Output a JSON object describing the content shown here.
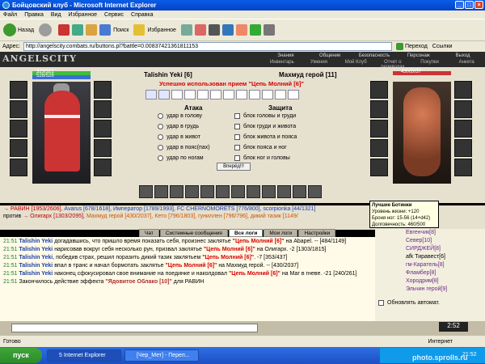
{
  "window": {
    "title": "Бойцовский клуб - Microsoft Internet Explorer"
  },
  "menu": [
    "Файл",
    "Правка",
    "Вид",
    "Избранное",
    "Сервис",
    "Справка"
  ],
  "toolbar": {
    "back": "Назад",
    "search": "Поиск",
    "favorites": "Избранное"
  },
  "address": {
    "label": "Адрес:",
    "url": "http://angelscity.combats.ru/buttons.pl?battle=0.00837421361811153",
    "go": "Переход",
    "links": "Ссылки"
  },
  "game": {
    "logo": "ANGELSCITY",
    "topnav": [
      "Знания",
      "Общение",
      "Безопасность",
      "Персонаж",
      "Выход"
    ],
    "subnav": [
      "Инвентарь",
      "Умения",
      "Мой Клуб",
      "Отчет о переводах",
      "Покупки",
      "Анкета"
    ]
  },
  "battle": {
    "left_hp": "323/321",
    "left_mana": "528/528",
    "right_hp": "430/2037",
    "left_name": "Talishin Yeki [6]",
    "right_name": "Махмуд герой [11]",
    "success": "Успешно использован прием \"Цепь Молний [6]\"",
    "attack_title": "Атака",
    "defense_title": "Защита",
    "attack": [
      "удар в голову",
      "удар в грудь",
      "удар в живот",
      "удар в пояс(пах)",
      "удар по ногам"
    ],
    "defense": [
      "блок головы и груди",
      "блок груди и живота",
      "блок живота и пояса",
      "блок пояса и ног",
      "блок ног и головы"
    ],
    "forward": "Вперёд!!!"
  },
  "lines": {
    "ravin": "→ РАВИН [1953/2606],",
    "avarus": "Avarus [678/1618],",
    "emperor": "Император [1789/1993],",
    "fc": "FC CHERNOMORETS [776/800],",
    "scorp": "scorpionka [44/1321]",
    "vs": "против",
    "olig": "→ Олигарх [1303/2095],",
    "mahmud": "Махмуд герой [430/2037],",
    "keto": "Кето [796/1803],",
    "gun": "гуниллен [796/796],",
    "dikiy": "дикий тазик [1149/"
  },
  "tooltip": {
    "title": "Лучшие Ботинки",
    "l1": "Уровень жизни: +120",
    "l2": "Броня ног: 15-56 (14+d42)",
    "l3": "Долговечность: 460/500"
  },
  "chat_tabs": [
    "Чат",
    "Системные сообщения",
    "Все логи",
    "Мои логи",
    "Настройки"
  ],
  "log": [
    {
      "t": "21:51",
      "a": "Talishin Yeki",
      "b": " догадавшись, что пришло время показать себя, произнес заклятье ",
      "c": "\"Цепь Молний [6]\"",
      "d": " на Abapel. -- [484/1149]"
    },
    {
      "t": "21:51",
      "a": "Talishin Yeki",
      "b": " нарисовав вокруг себя несколько рун, призвал заклятье ",
      "c": "\"Цепь Молний [6]\"",
      "d": " на Олигарх. -2 [1303/1815]"
    },
    {
      "t": "21:51",
      "a": "Talishin Yeki",
      "b": ", победив страх, решил поразить дикий тазик заклятьем ",
      "c": "\"Цепь Молний [6]\"",
      "d": ". -7 [353/437]"
    },
    {
      "t": "21:51",
      "a": "Talishin Yeki",
      "b": " впал в транс и начал бормотать заклятье ",
      "c": "\"Цепь Молний [6]\"",
      "d": " на Махмуд герой. -- [430/2037]"
    },
    {
      "t": "21:51",
      "a": "Talishin Yeki",
      "b": " наконец сфокусировал свое внимание на поединке и наколдовал ",
      "c": "\"Цепь Молний [6]\"",
      "d": " на Маг в гневе. -21 [240/261]"
    },
    {
      "t": "21:51",
      "a": "",
      "b": "Закончилось действие эффекта ",
      "c": "\"Ядовитое Облако [10]\"",
      "d": " для РАВИН"
    }
  ],
  "online": [
    "Евгенчик[8]",
    "Север[10]",
    "СИРДЖЕЙ[8]",
    "afk Тиравест[6]",
    "гм-Каратель[8]",
    "Фламбер[8]",
    "Хородрим[8]",
    "Эльчин герой[9]"
  ],
  "auto_update": "Обновлять автомат.",
  "clock": "2:52",
  "statusbar": {
    "done": "Готово",
    "zone": "Интернет"
  },
  "taskbar": {
    "start": "пуск",
    "t1": "5 Internet Explorer",
    "t2": "[Чер_Мет] - Переп...",
    "time": "21:52"
  },
  "watermark": "photo.sprolls.ru"
}
